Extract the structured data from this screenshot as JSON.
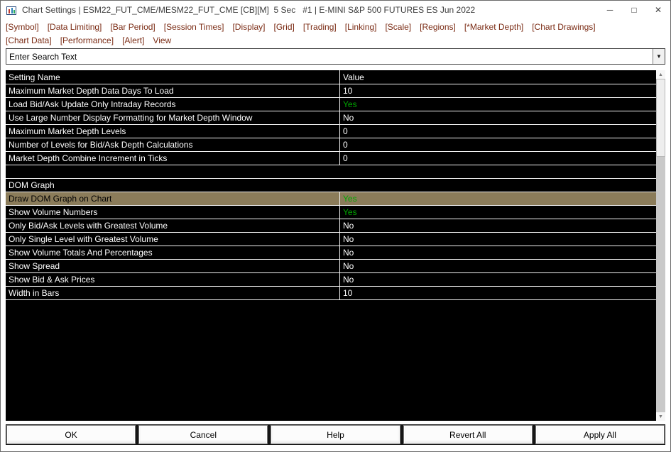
{
  "window": {
    "title": "Chart Settings | ESM22_FUT_CME/MESM22_FUT_CME [CB][M]  5 Sec   #1 | E-MINI S&P 500 FUTURES ES Jun 2022",
    "controls": {
      "minimize": "─",
      "maximize": "□",
      "close": "✕"
    }
  },
  "menu": {
    "row1": [
      "[Symbol]",
      "[Data Limiting]",
      "[Bar Period]",
      "[Session Times]",
      "[Display]",
      "[Grid]",
      "[Trading]",
      "[Linking]",
      "[Scale]",
      "[Regions]",
      "[*Market Depth]",
      "[Chart Drawings]"
    ],
    "row2": [
      "[Chart Data]",
      "[Performance]",
      "[Alert]",
      "View"
    ]
  },
  "search": {
    "value": "Enter Search Text",
    "dropdown_glyph": "▼"
  },
  "table": {
    "headers": [
      "Setting Name",
      "Value"
    ],
    "rows": [
      {
        "type": "setting",
        "name": "Maximum Market Depth Data Days To Load",
        "value": "10",
        "value_style": "plain",
        "selected": false
      },
      {
        "type": "setting",
        "name": "Load Bid/Ask Update Only Intraday Records",
        "value": "Yes",
        "value_style": "green",
        "selected": false
      },
      {
        "type": "setting",
        "name": "Use Large Number Display Formatting for Market Depth Window",
        "value": "No",
        "value_style": "plain",
        "selected": false
      },
      {
        "type": "setting",
        "name": "Maximum Market Depth Levels",
        "value": "0",
        "value_style": "plain",
        "selected": false
      },
      {
        "type": "setting",
        "name": "Number of Levels for Bid/Ask Depth Calculations",
        "value": "0",
        "value_style": "plain",
        "selected": false
      },
      {
        "type": "setting",
        "name": "Market Depth Combine Increment in Ticks",
        "value": "0",
        "value_style": "plain",
        "selected": false
      },
      {
        "type": "empty",
        "name": "",
        "value": "",
        "value_style": "plain",
        "selected": false
      },
      {
        "type": "section",
        "name": "DOM Graph",
        "value": "",
        "value_style": "plain",
        "selected": false
      },
      {
        "type": "setting",
        "name": "Draw DOM Graph on Chart",
        "value": "Yes",
        "value_style": "green",
        "selected": true
      },
      {
        "type": "setting",
        "name": "Show Volume Numbers",
        "value": "Yes",
        "value_style": "green",
        "selected": false
      },
      {
        "type": "setting",
        "name": "Only Bid/Ask Levels with Greatest Volume",
        "value": "No",
        "value_style": "plain",
        "selected": false
      },
      {
        "type": "setting",
        "name": "Only Single Level with Greatest Volume",
        "value": "No",
        "value_style": "plain",
        "selected": false
      },
      {
        "type": "setting",
        "name": "Show Volume Totals And Percentages",
        "value": "No",
        "value_style": "plain",
        "selected": false
      },
      {
        "type": "setting",
        "name": "Show Spread",
        "value": "No",
        "value_style": "plain",
        "selected": false
      },
      {
        "type": "setting",
        "name": "Show Bid & Ask Prices",
        "value": "No",
        "value_style": "plain",
        "selected": false
      },
      {
        "type": "setting",
        "name": "Width in Bars",
        "value": "10",
        "value_style": "plain",
        "selected": false
      }
    ]
  },
  "buttons": [
    "OK",
    "Cancel",
    "Help",
    "Revert All",
    "Apply All"
  ],
  "scrollbar": {
    "up_glyph": "▲",
    "down_glyph": "▼"
  },
  "colors": {
    "menu_text": "#7b2c15",
    "value_yes_green": "#00a800",
    "selected_row_bg": "#8b7c5a",
    "table_bg": "#000000",
    "grid_line": "#f2f2f2"
  }
}
